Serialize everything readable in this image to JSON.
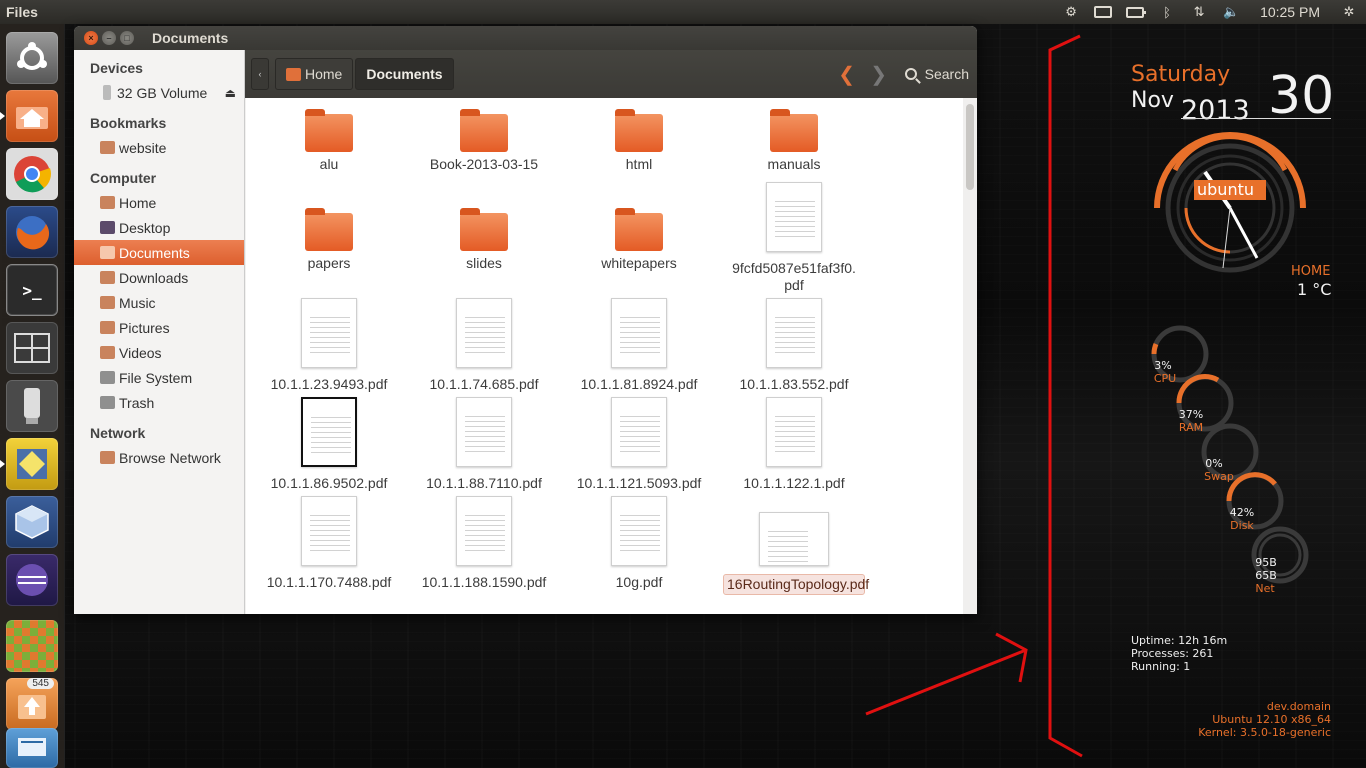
{
  "topbar": {
    "app_title": "Files",
    "clock": "10:25 PM",
    "indicator_icons": [
      "network-icon",
      "keyboard-icon",
      "battery-icon",
      "bluetooth-icon",
      "transfer-icon",
      "volume-icon",
      "gear-icon"
    ]
  },
  "launcher": {
    "items": [
      {
        "name": "dash-button",
        "icon": "ubuntu-logo-icon"
      },
      {
        "name": "files-launcher",
        "icon": "files-icon"
      },
      {
        "name": "chrome-launcher",
        "icon": "chrome-icon"
      },
      {
        "name": "firefox-launcher",
        "icon": "firefox-icon"
      },
      {
        "name": "terminal-launcher",
        "icon": "terminal-icon",
        "glyph": ">_"
      },
      {
        "name": "workspaces-launcher",
        "icon": "workspaces-icon"
      },
      {
        "name": "usb-launcher",
        "icon": "usb-icon"
      },
      {
        "name": "app-launcher-yellow",
        "icon": "app-icon"
      },
      {
        "name": "virtualbox-launcher",
        "icon": "virtualbox-icon"
      },
      {
        "name": "eclipse-launcher",
        "icon": "eclipse-icon"
      },
      {
        "name": "checker-app-launcher",
        "icon": "checker-icon"
      },
      {
        "name": "update-manager-launcher",
        "icon": "update-icon",
        "badge": "545"
      },
      {
        "name": "scanner-launcher",
        "icon": "scanner-icon"
      }
    ]
  },
  "window": {
    "title": "Documents",
    "close_glyph": "×",
    "min_glyph": "–",
    "max_glyph": "□"
  },
  "sidebar": {
    "sections": [
      {
        "heading": "Devices",
        "items": [
          {
            "label": "32 GB Volume",
            "icon": "drive-icon",
            "eject": "⏏"
          }
        ]
      },
      {
        "heading": "Bookmarks",
        "items": [
          {
            "label": "website",
            "icon": "folder-icon"
          }
        ]
      },
      {
        "heading": "Computer",
        "items": [
          {
            "label": "Home",
            "icon": "home-folder-icon"
          },
          {
            "label": "Desktop",
            "icon": "desktop-icon"
          },
          {
            "label": "Documents",
            "icon": "documents-folder-icon",
            "active": true
          },
          {
            "label": "Downloads",
            "icon": "downloads-folder-icon"
          },
          {
            "label": "Music",
            "icon": "music-folder-icon"
          },
          {
            "label": "Pictures",
            "icon": "pictures-folder-icon"
          },
          {
            "label": "Videos",
            "icon": "videos-folder-icon"
          },
          {
            "label": "File System",
            "icon": "filesystem-icon"
          },
          {
            "label": "Trash",
            "icon": "trash-icon"
          }
        ]
      },
      {
        "heading": "Network",
        "items": [
          {
            "label": "Browse Network",
            "icon": "network-icon"
          }
        ]
      }
    ]
  },
  "toolbar": {
    "back_glyph": "‹",
    "crumb_home": "Home",
    "crumb_current": "Documents",
    "nav_back_glyph": "❮",
    "nav_forward_glyph": "❯",
    "search_label": "Search"
  },
  "files": [
    {
      "label": "alu",
      "type": "folder"
    },
    {
      "label": "Book-2013-03-15",
      "type": "folder"
    },
    {
      "label": "html",
      "type": "folder"
    },
    {
      "label": "manuals",
      "type": "folder"
    },
    {
      "label": "papers",
      "type": "folder"
    },
    {
      "label": "slides",
      "type": "folder"
    },
    {
      "label": "whitepapers",
      "type": "folder"
    },
    {
      "label": "9fcfd5087e51faf3f0.pdf",
      "type": "pdf"
    },
    {
      "label": "10.1.1.23.9493.pdf",
      "type": "pdf"
    },
    {
      "label": "10.1.1.74.685.pdf",
      "type": "pdf"
    },
    {
      "label": "10.1.1.81.8924.pdf",
      "type": "pdf"
    },
    {
      "label": "10.1.1.83.552.pdf",
      "type": "pdf"
    },
    {
      "label": "10.1.1.86.9502.pdf",
      "type": "pdf"
    },
    {
      "label": "10.1.1.88.7110.pdf",
      "type": "pdf"
    },
    {
      "label": "10.1.1.121.5093.pdf",
      "type": "pdf"
    },
    {
      "label": "10.1.1.122.1.pdf",
      "type": "pdf"
    },
    {
      "label": "10.1.1.170.7488.pdf",
      "type": "pdf"
    },
    {
      "label": "10.1.1.188.1590.pdf",
      "type": "pdf"
    },
    {
      "label": "10g.pdf",
      "type": "pdf"
    },
    {
      "label": "16RoutingTopology.pdf",
      "type": "pdf",
      "selected": true
    }
  ],
  "conky": {
    "day_of_week": "Saturday",
    "month": "Nov",
    "year": "2013",
    "day": "30",
    "clock_logo": "ubuntu",
    "location": "HOME",
    "temperature": "1 °C",
    "gauges": [
      {
        "value": "3%",
        "label": "CPU",
        "level": 0.03
      },
      {
        "value": "37%",
        "label": "RAM",
        "level": 0.37
      },
      {
        "value": "0%",
        "label": "Swap",
        "level": 0.0
      },
      {
        "value": "42%",
        "label": "Disk",
        "level": 0.42
      },
      {
        "value": "95B",
        "value2": "65B",
        "label": "Net",
        "level": 0.0
      }
    ],
    "uptime": "Uptime: 12h 16m",
    "processes": "Processes: 261",
    "running": "Running: 1",
    "hostname": "dev.domain",
    "os": "Ubuntu 12.10  x86_64",
    "kernel": "Kernel: 3.5.0-18-generic"
  },
  "colors": {
    "accent": "#e8702a",
    "selection": "#dd5f2e",
    "annotation": "#e01010"
  }
}
